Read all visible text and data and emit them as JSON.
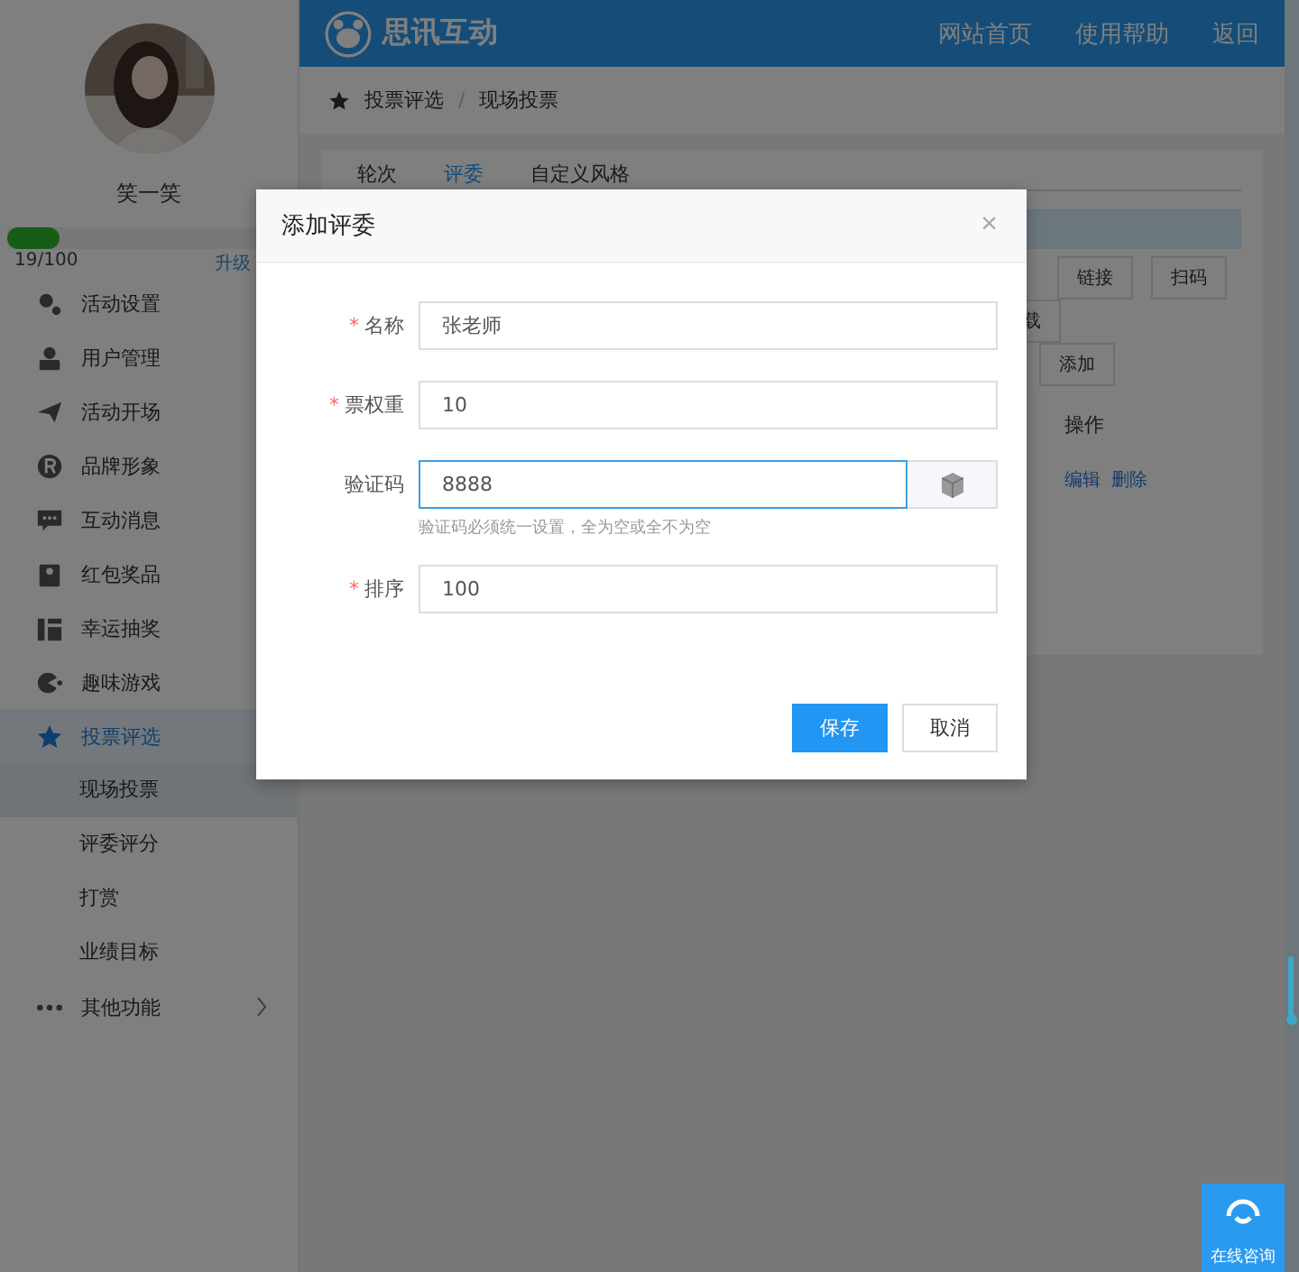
{
  "sidebar": {
    "user_name": "笑一笑",
    "progress": {
      "level": 0.19,
      "reading": "19/100",
      "upgrade_link": "升级"
    },
    "items": [
      {
        "label": "活动设置",
        "kind": "gears",
        "selected": false
      },
      {
        "label": "用户管理",
        "kind": "user",
        "selected": false
      },
      {
        "label": "活动开场",
        "kind": "plane",
        "selected": false
      },
      {
        "label": "品牌形象",
        "kind": "brand",
        "selected": false
      },
      {
        "label": "互动消息",
        "kind": "chat",
        "selected": false
      },
      {
        "label": "红包奖品",
        "kind": "gift",
        "selected": false
      },
      {
        "label": "幸运抽奖",
        "kind": "lottery",
        "selected": false
      },
      {
        "label": "趣味游戏",
        "kind": "game",
        "selected": false
      },
      {
        "label": "投票评选",
        "kind": "star",
        "selected": true,
        "expanded": true,
        "children": [
          {
            "label": "现场投票",
            "selected": true
          },
          {
            "label": "评委评分",
            "selected": false
          },
          {
            "label": "打赏",
            "selected": false
          },
          {
            "label": "业绩目标",
            "selected": false
          }
        ]
      },
      {
        "label": "其他功能",
        "kind": "dots",
        "selected": false,
        "has_submenu": true
      }
    ]
  },
  "header": {
    "brand": "思讯互动",
    "links": [
      "网站首页",
      "使用帮助",
      "返回"
    ]
  },
  "breadcrumb": {
    "separator": "/",
    "items": [
      "投票评选",
      "现场投票"
    ]
  },
  "tabs": [
    {
      "label": "轮次",
      "selected": false
    },
    {
      "label": "评委",
      "selected": true
    },
    {
      "label": "自定义风格",
      "selected": false
    }
  ],
  "toolbar": {
    "row_1": [
      "链接",
      "扫码"
    ],
    "row_2": [
      "载"
    ],
    "row_3": [
      "添加"
    ]
  },
  "table": {
    "columns": [
      "操作"
    ],
    "rows": [
      {
        "actions": [
          "编辑",
          "删除"
        ]
      }
    ]
  },
  "dialog": {
    "title": "添加评委",
    "close": "×",
    "required_mark": "*",
    "fields": [
      {
        "kind": "text",
        "label": "名称",
        "required": true,
        "value": "张老师",
        "focused": false
      },
      {
        "kind": "text",
        "label": "票权重",
        "required": true,
        "value": "10",
        "focused": false
      },
      {
        "kind": "code",
        "label": "验证码",
        "required": false,
        "value": "8888",
        "focused": true,
        "hint": "验证码必须统一设置，全为空或全不为空"
      },
      {
        "kind": "text",
        "label": "排序",
        "required": true,
        "value": "100",
        "focused": false
      }
    ],
    "buttons": [
      {
        "label": "保存",
        "primary": true
      },
      {
        "label": "取消",
        "primary": false
      }
    ]
  },
  "help_button": "在线咨询"
}
